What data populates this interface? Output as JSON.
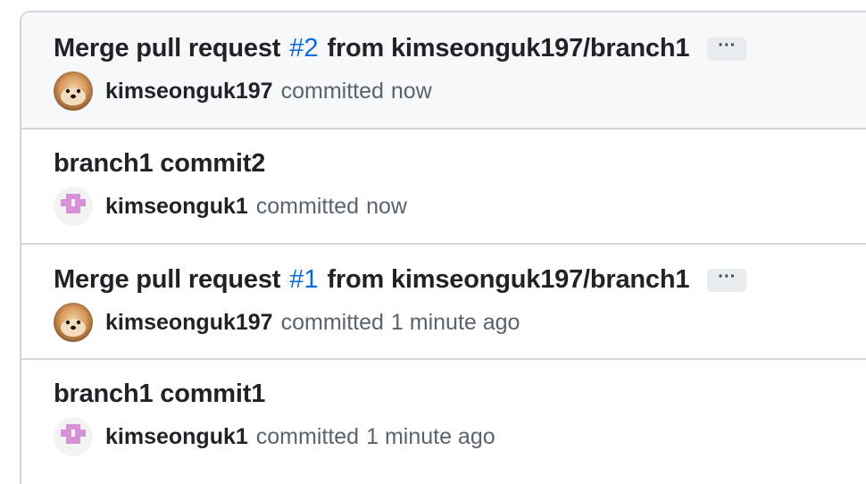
{
  "commits": [
    {
      "title_prefix": "Merge pull request",
      "pr_number": "#2",
      "title_suffix": "from kimseonguk197/branch1",
      "author": "kimseonguk197",
      "verb": "committed",
      "time": "now",
      "avatar": "dog-photo-avatar",
      "more_label": "···"
    },
    {
      "title": "branch1 commit2",
      "author": "kimseonguk1",
      "verb": "committed",
      "time": "now",
      "avatar": "identicon-avatar"
    },
    {
      "title_prefix": "Merge pull request",
      "pr_number": "#1",
      "title_suffix": "from kimseonguk197/branch1",
      "author": "kimseonguk197",
      "verb": "committed",
      "time": "1 minute ago",
      "avatar": "dog-photo-avatar",
      "more_label": "···"
    },
    {
      "title": "branch1 commit1",
      "author": "kimseonguk1",
      "verb": "committed",
      "time": "1 minute ago",
      "avatar": "identicon-avatar"
    }
  ],
  "colors": {
    "link": "#0969da",
    "border": "#d0d7de",
    "highlight_bg": "#f6f8fa",
    "muted_text": "#59636e",
    "identicon": "#d792d5"
  }
}
